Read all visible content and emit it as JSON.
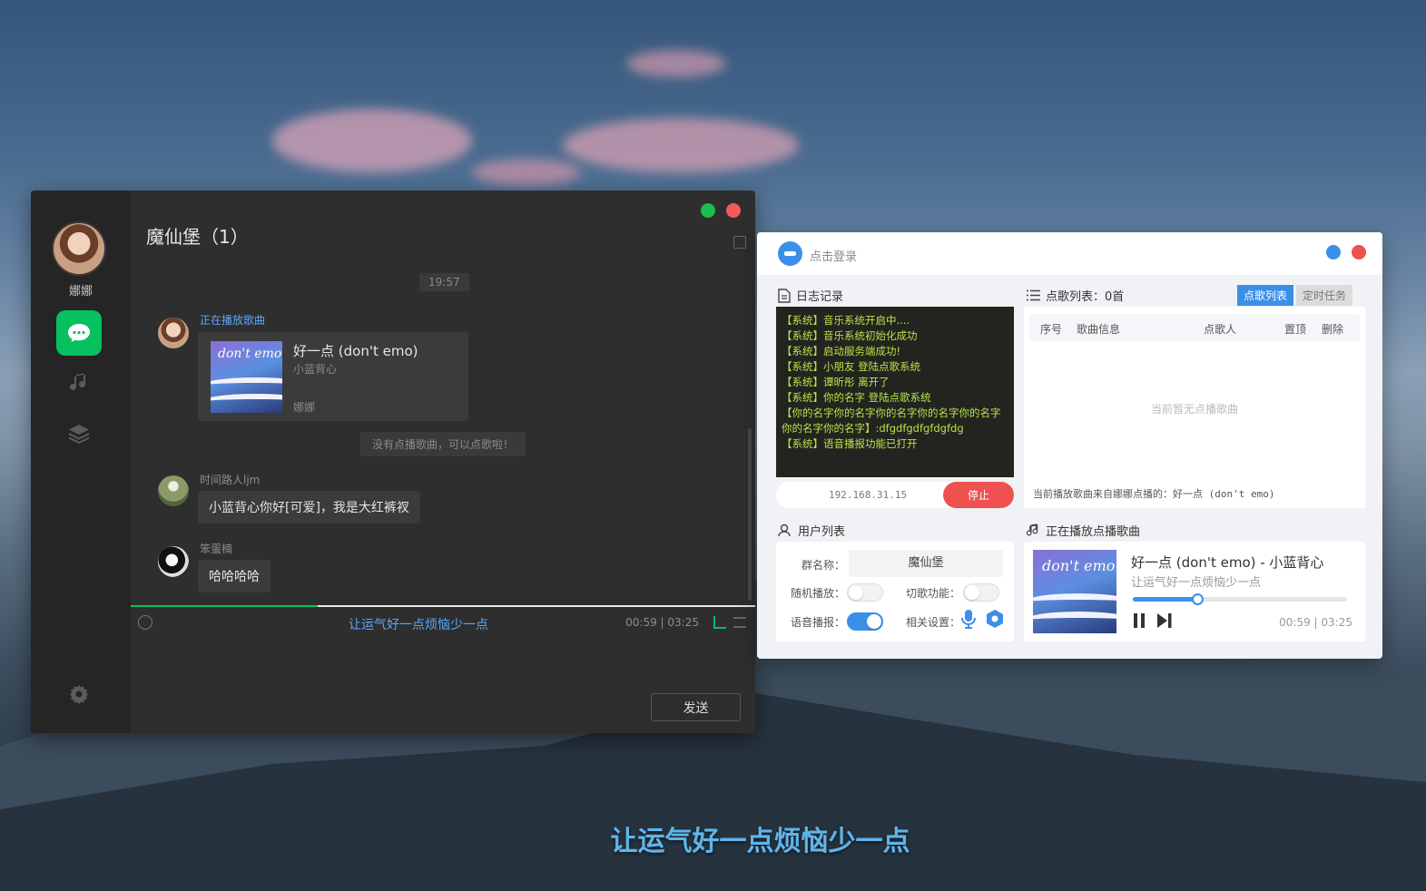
{
  "chat": {
    "user_name": "娜娜",
    "title": "魔仙堡（1）",
    "time_chip": "19:57",
    "now_playing_label": "正在播放歌曲",
    "song": {
      "title": "好一点 (don't emo)",
      "artist": "小蓝背心",
      "requester": "娜娜",
      "cover_script": "don't emo"
    },
    "notice": "没有点播歌曲，可以点歌啦！",
    "messages": [
      {
        "sender": "时间路人ljm",
        "text": "小蓝背心你好[可爱]，我是大红裤衩"
      },
      {
        "sender": "笨蛋楠",
        "text": "哈哈哈哈"
      }
    ],
    "lyric": "让运气好一点烦恼少一点",
    "time": "00:59 | 03:25",
    "progress": 0.3,
    "send_label": "发送"
  },
  "music": {
    "login_text": "点击登录",
    "log_title": "日志记录",
    "log_lines": [
      "【系统】音乐系统开启中....",
      "【系统】音乐系统初始化成功",
      "【系统】启动服务端成功!",
      "【系统】小朋友 登陆点歌系统",
      "【系统】谭昕彤 离开了",
      "【系统】你的名字 登陆点歌系统",
      "【你的名字你的名字你的名字你的名字你的名字你的名字你的名字】:dfgdfgdfgfdgfdg",
      "【系统】语音播报功能已打开"
    ],
    "ip": "192.168.31.15",
    "stop_label": "停止",
    "request_title": "点歌列表：0首",
    "tabs": [
      "点歌列表",
      "定时任务"
    ],
    "table_headers": [
      "序号",
      "歌曲信息",
      "点歌人",
      "置顶",
      "删除"
    ],
    "empty_text": "当前暂无点播歌曲",
    "current_source": "当前播放歌曲来自娜娜点播的：好一点 (don't emo)",
    "user_title": "用户列表",
    "group_label": "群名称：",
    "group_name": "魔仙堡",
    "random_label": "随机播放：",
    "skip_label": "切歌功能：",
    "voice_label": "语音播报：",
    "settings_label": "相关设置：",
    "now_title": "正在播放点播歌曲",
    "now_song": "好一点 (don't emo) - 小蓝背心",
    "now_lyric": "让运气好一点烦恼少一点",
    "now_time": "00:59 | 03:25",
    "now_progress": 0.3,
    "toggles": {
      "random": false,
      "skip": false,
      "voice": true
    }
  },
  "subtitle": "让运气好一点烦恼少一点",
  "colors": {
    "wechat_green": "#07c160",
    "accent_blue": "#3b8fe8",
    "stop_red": "#ef5151"
  }
}
